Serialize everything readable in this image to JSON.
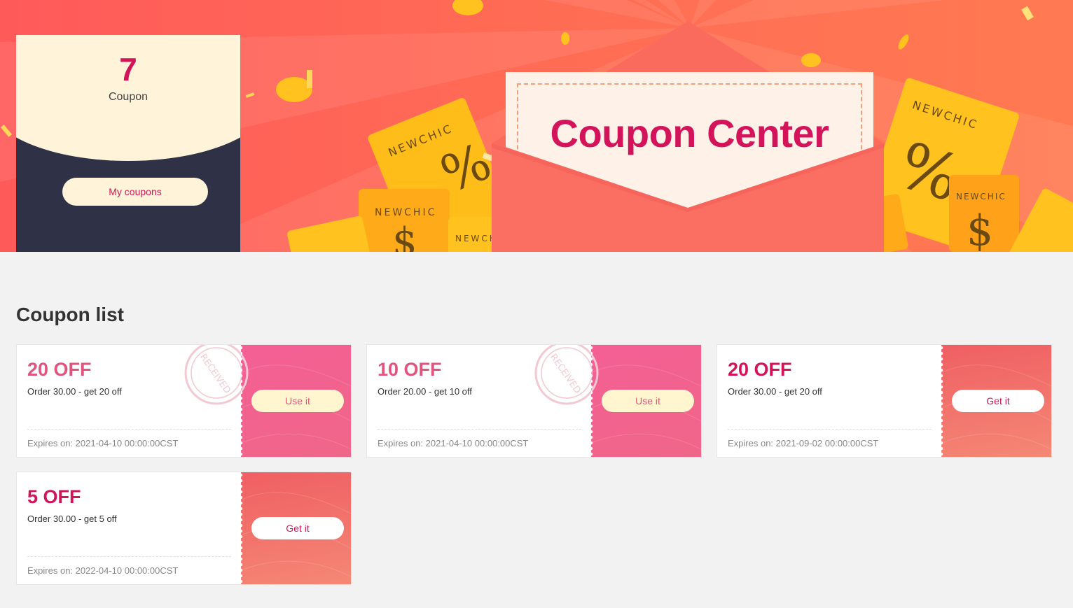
{
  "banner": {
    "title": "Coupon Center",
    "brand_text": "NEWCHIC",
    "coupon_count": "7",
    "coupon_count_label": "Coupon",
    "my_coupons_label": "My coupons"
  },
  "coupon_list": {
    "title": "Coupon list",
    "items": [
      {
        "amount": "20 OFF",
        "desc": "Order 30.00 - get 20 off",
        "expiry": "Expires on: 2021-04-10 00:00:00CST",
        "button": "Use it",
        "status": "received",
        "stamp": "RECEIVED"
      },
      {
        "amount": "10 OFF",
        "desc": "Order 20.00 - get 10 off",
        "expiry": "Expires on: 2021-04-10 00:00:00CST",
        "button": "Use it",
        "status": "received",
        "stamp": "RECEIVED"
      },
      {
        "amount": "20 OFF",
        "desc": "Order 30.00 - get 20 off",
        "expiry": "Expires on: 2021-09-02 00:00:00CST",
        "button": "Get it",
        "status": "available"
      },
      {
        "amount": "5 OFF",
        "desc": "Order 30.00 - get 5 off",
        "expiry": "Expires on: 2022-04-10 00:00:00CST",
        "button": "Get it",
        "status": "available"
      }
    ]
  },
  "colors": {
    "accent": "#d4145a",
    "banner_red": "#ff5a5a",
    "ticket_yellow": "#ffc400",
    "card_dark": "#2f3247",
    "cream": "#fff3d9"
  }
}
